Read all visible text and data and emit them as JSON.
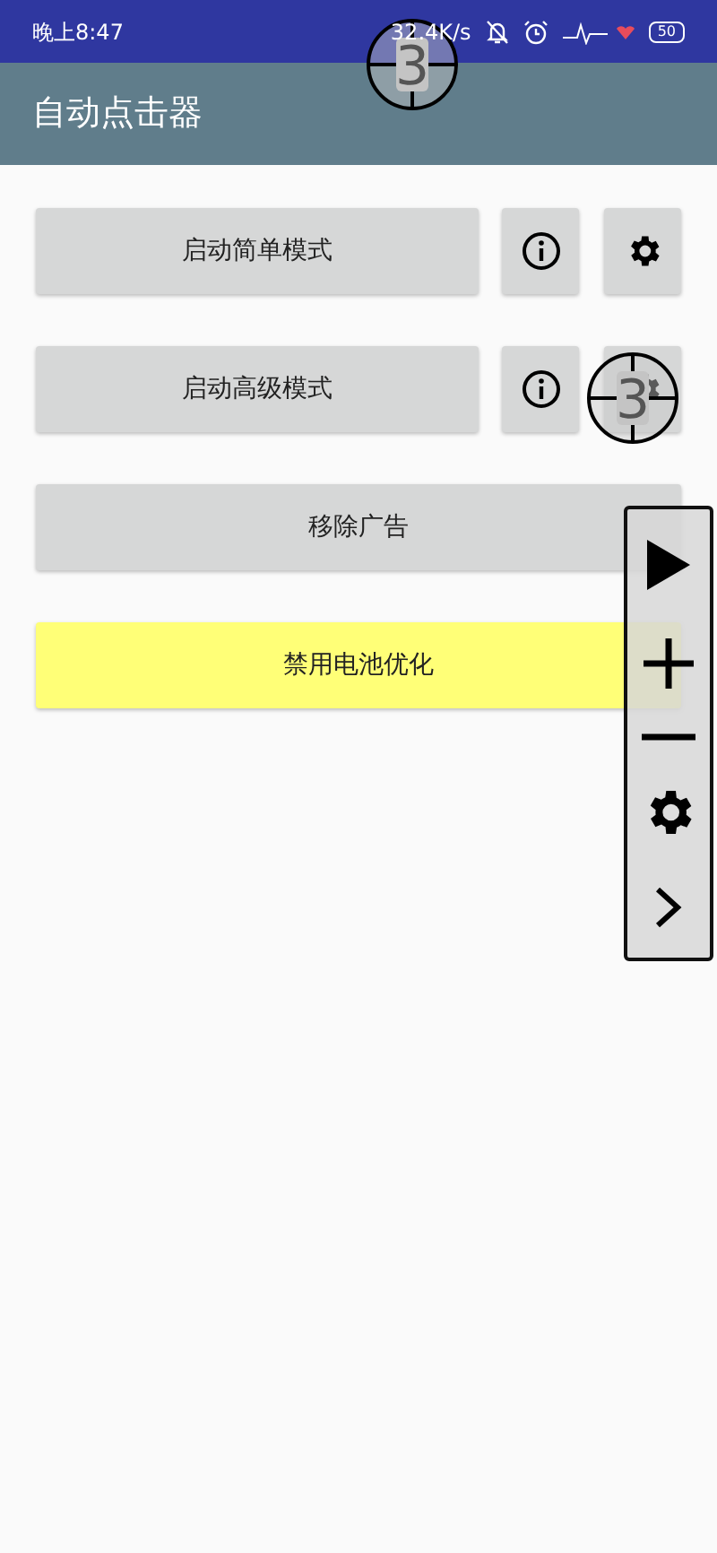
{
  "status_bar": {
    "time": "晚上8:47",
    "net_speed": "32.4K/s",
    "battery": "50"
  },
  "app_bar": {
    "title": "自动点击器"
  },
  "rows": [
    {
      "kind": "mode",
      "label": "启动简单模式"
    },
    {
      "kind": "mode",
      "label": "启动高级模式"
    },
    {
      "kind": "wide",
      "label": "移除广告"
    },
    {
      "kind": "highlight",
      "label": "禁用电池优化"
    }
  ],
  "targets": [
    {
      "label": "3"
    },
    {
      "label": "3"
    }
  ]
}
